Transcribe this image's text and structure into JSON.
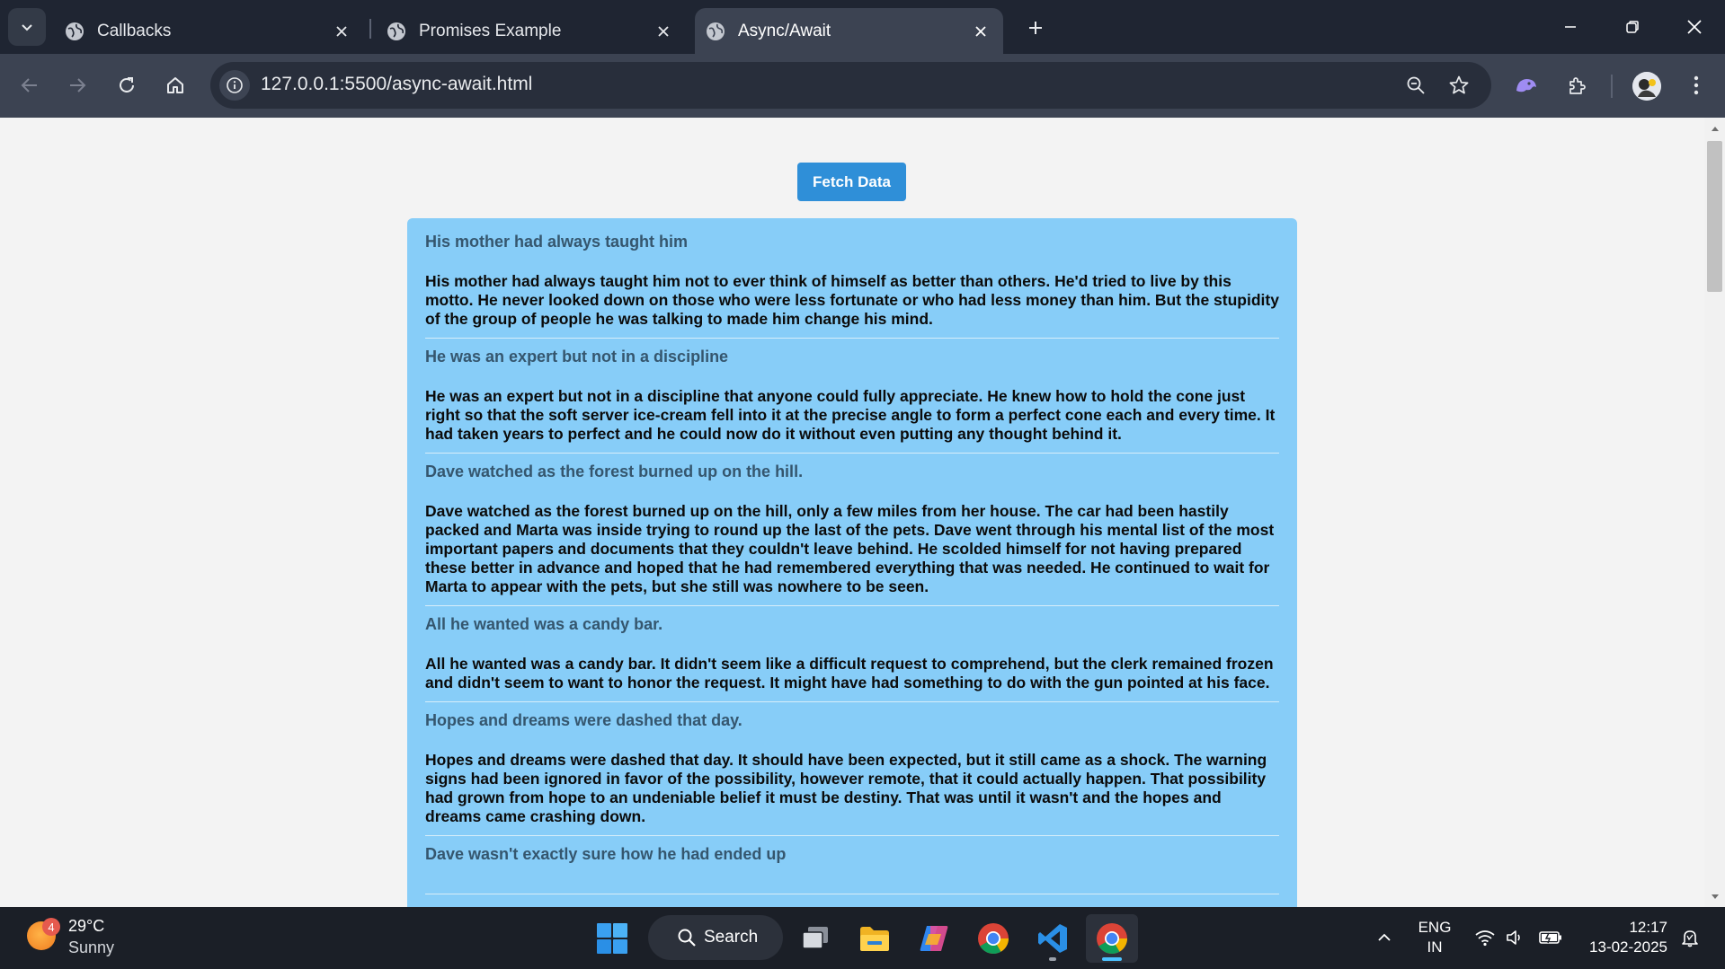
{
  "browser": {
    "tabs": [
      {
        "title": "Callbacks",
        "active": false
      },
      {
        "title": "Promises Example",
        "active": false
      },
      {
        "title": "Async/Await",
        "active": true
      }
    ],
    "url": "127.0.0.1:5500/async-await.html"
  },
  "page": {
    "fetch_button_label": "Fetch Data",
    "posts": [
      {
        "title": "His mother had always taught him",
        "body": "His mother had always taught him not to ever think of himself as better than others. He'd tried to live by this motto. He never looked down on those who were less fortunate or who had less money than him. But the stupidity of the group of people he was talking to made him change his mind."
      },
      {
        "title": "He was an expert but not in a discipline",
        "body": "He was an expert but not in a discipline that anyone could fully appreciate. He knew how to hold the cone just right so that the soft server ice-cream fell into it at the precise angle to form a perfect cone each and every time. It had taken years to perfect and he could now do it without even putting any thought behind it."
      },
      {
        "title": "Dave watched as the forest burned up on the hill.",
        "body": "Dave watched as the forest burned up on the hill, only a few miles from her house. The car had been hastily packed and Marta was inside trying to round up the last of the pets. Dave went through his mental list of the most important papers and documents that they couldn't leave behind. He scolded himself for not having prepared these better in advance and hoped that he had remembered everything that was needed. He continued to wait for Marta to appear with the pets, but she still was nowhere to be seen."
      },
      {
        "title": "All he wanted was a candy bar.",
        "body": "All he wanted was a candy bar. It didn't seem like a difficult request to comprehend, but the clerk remained frozen and didn't seem to want to honor the request. It might have had something to do with the gun pointed at his face."
      },
      {
        "title": "Hopes and dreams were dashed that day.",
        "body": "Hopes and dreams were dashed that day. It should have been expected, but it still came as a shock. The warning signs had been ignored in favor of the possibility, however remote, that it could actually happen. That possibility had grown from hope to an undeniable belief it must be destiny. That was until it wasn't and the hopes and dreams came crashing down."
      },
      {
        "title": "Dave wasn't exactly sure how he had ended up",
        "body": ""
      }
    ]
  },
  "taskbar": {
    "weather": {
      "badge": "4",
      "temp": "29°C",
      "condition": "Sunny"
    },
    "search_label": "Search",
    "language": {
      "line1": "ENG",
      "line2": "IN"
    },
    "clock": {
      "time": "12:17",
      "date": "13-02-2025"
    },
    "apps": [
      "start",
      "search",
      "task-view",
      "file-explorer",
      "copilot",
      "chrome",
      "vscode",
      "chrome-active"
    ]
  },
  "colors": {
    "tabstrip_bg": "#1f2532",
    "toolbar_bg": "#3c4352",
    "fetch_button": "#2f8fd8",
    "posts_container": "#87cdf8",
    "post_title": "#35566e",
    "taskbar_bg": "#1b1f27"
  }
}
